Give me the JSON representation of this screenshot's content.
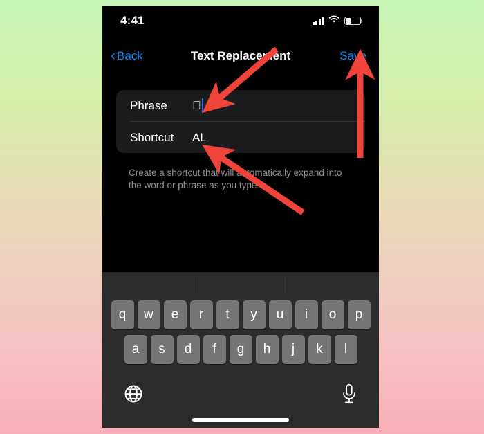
{
  "background": {
    "gradient_top": "#c6f5b8",
    "gradient_bottom": "#f9afb9"
  },
  "phone": {
    "status_bar": {
      "time": "4:41",
      "cellular_icon": "cellular-signal-icon",
      "wifi_icon": "wifi-icon",
      "battery_icon": "battery-low-icon",
      "battery_level_percent": 34
    },
    "nav_bar": {
      "back_label": "Back",
      "back_chevron": "chevron-left-icon",
      "title": "Text Replacement",
      "save_label": "Save",
      "accent_color": "#0a84ff"
    },
    "form": {
      "rows": [
        {
          "label": "Phrase",
          "value": "",
          "glyph": "apple-logo-glyph",
          "has_caret": true
        },
        {
          "label": "Shortcut",
          "value": "AL",
          "glyph": "",
          "has_caret": false
        }
      ],
      "helper_text": "Create a shortcut that will automatically expand into the word or phrase as you type.",
      "card_color": "#1c1c1e"
    },
    "keyboard": {
      "background_color": "#2c2c2c",
      "key_color": "#757575",
      "row1": [
        "q",
        "w",
        "e",
        "r",
        "t",
        "y",
        "u",
        "i",
        "o",
        "p"
      ],
      "row2": [
        "a",
        "s",
        "d",
        "f",
        "g",
        "h",
        "j",
        "k",
        "l"
      ],
      "globe_icon": "globe-icon",
      "mic_icon": "microphone-icon",
      "home_indicator": "home-indicator"
    }
  },
  "annotations": {
    "arrow_color": "#f0433a",
    "arrows": [
      {
        "name": "arrow-to-phrase-field",
        "points_at": "Phrase"
      },
      {
        "name": "arrow-to-save-button",
        "points_at": "Save"
      },
      {
        "name": "arrow-to-shortcut-field",
        "points_at": "Shortcut"
      }
    ]
  }
}
